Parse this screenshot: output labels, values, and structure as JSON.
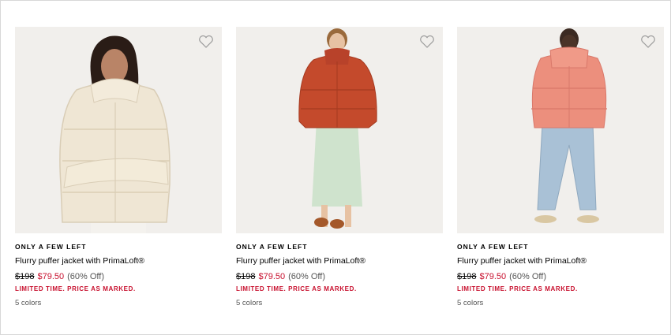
{
  "colors": {
    "sale": "#c8102e",
    "muted": "#555555",
    "border": "#d8d8d8"
  },
  "products": [
    {
      "badge": "ONLY A FEW LEFT",
      "name": "Flurry puffer jacket with PrimaLoft®",
      "original_price": "$198",
      "sale_price": "$79.50",
      "discount": "(60% Off)",
      "promo": "LIMITED TIME. PRICE AS MARKED.",
      "colors_label": "5 colors",
      "jacket_color": "ivory",
      "icon": "heart-icon"
    },
    {
      "badge": "ONLY A FEW LEFT",
      "name": "Flurry puffer jacket with PrimaLoft®",
      "original_price": "$198",
      "sale_price": "$79.50",
      "discount": "(60% Off)",
      "promo": "LIMITED TIME. PRICE AS MARKED.",
      "colors_label": "5 colors",
      "jacket_color": "rust red",
      "icon": "heart-icon"
    },
    {
      "badge": "ONLY A FEW LEFT",
      "name": "Flurry puffer jacket with PrimaLoft®",
      "original_price": "$198",
      "sale_price": "$79.50",
      "discount": "(60% Off)",
      "promo": "LIMITED TIME. PRICE AS MARKED.",
      "colors_label": "5 colors",
      "jacket_color": "coral pink",
      "icon": "heart-icon"
    }
  ]
}
